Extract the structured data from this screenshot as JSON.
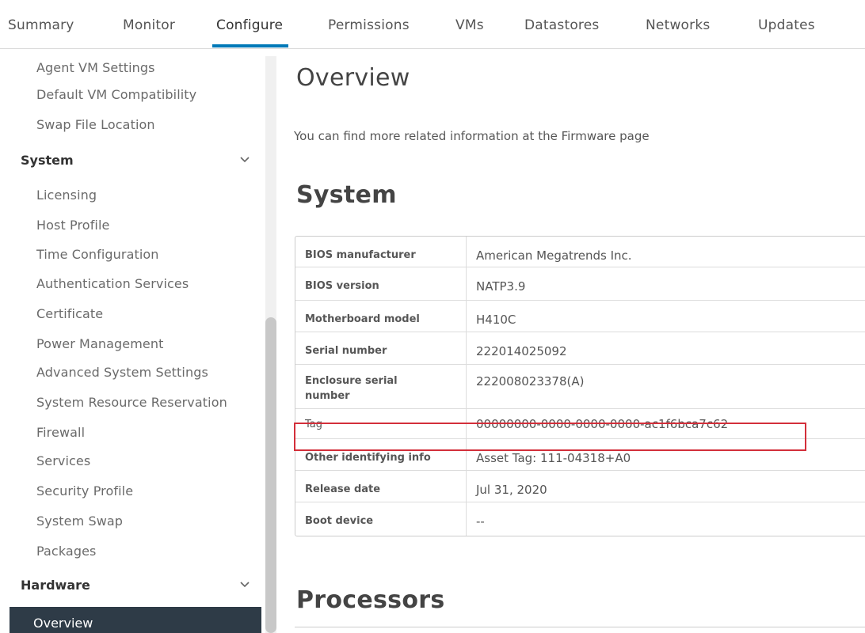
{
  "tabs": [
    {
      "label": "Summary"
    },
    {
      "label": "Monitor"
    },
    {
      "label": "Configure"
    },
    {
      "label": "Permissions"
    },
    {
      "label": "VMs"
    },
    {
      "label": "Datastores"
    },
    {
      "label": "Networks"
    },
    {
      "label": "Updates"
    }
  ],
  "active_tab": "Configure",
  "sidebar": {
    "top_items": [
      {
        "label": "Agent VM Settings"
      },
      {
        "label": "Default VM Compatibility"
      },
      {
        "label": "Swap File Location"
      }
    ],
    "system_group": {
      "label": "System",
      "chevron": "chevron-down-icon"
    },
    "system_items": [
      {
        "label": "Licensing"
      },
      {
        "label": "Host Profile"
      },
      {
        "label": "Time Configuration"
      },
      {
        "label": "Authentication Services"
      },
      {
        "label": "Certificate"
      },
      {
        "label": "Power Management"
      },
      {
        "label": "Advanced System Settings"
      },
      {
        "label": "System Resource Reservation"
      },
      {
        "label": "Firewall"
      },
      {
        "label": "Services"
      },
      {
        "label": "Security Profile"
      },
      {
        "label": "System Swap"
      },
      {
        "label": "Packages"
      }
    ],
    "hardware_group": {
      "label": "Hardware",
      "chevron": "chevron-down-icon"
    },
    "selected_item": {
      "label": "Overview"
    }
  },
  "main": {
    "title": "Overview",
    "info_text": "You can find more related information at the Firmware page",
    "system_heading": "System",
    "system_rows": [
      {
        "label": "BIOS manufacturer",
        "value": "American Megatrends Inc."
      },
      {
        "label": "BIOS version",
        "value": "NATP3.9"
      },
      {
        "label": "Motherboard model",
        "value": "H410C"
      },
      {
        "label": "Serial number",
        "value": "222014025092"
      },
      {
        "label": "Enclosure serial number",
        "value": "222008023378(A)"
      },
      {
        "label": "Tag",
        "value": "00000000-0000-0000-0000-ac1f6bca7c62"
      },
      {
        "label": "Other identifying info",
        "value": "Asset Tag: 111-04318+A0"
      },
      {
        "label": "Release date",
        "value": "Jul 31, 2020"
      },
      {
        "label": "Boot device",
        "value": "--"
      }
    ],
    "processors_heading": "Processors"
  },
  "colors": {
    "accent": "#0079b8",
    "selected_bg": "#2e3b47",
    "highlight_border": "#d32f3a"
  }
}
